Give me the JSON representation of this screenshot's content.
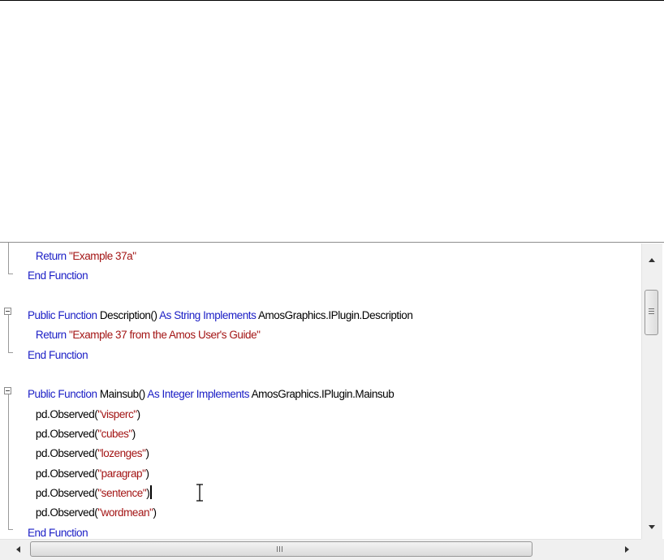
{
  "editor": {
    "lines": [
      {
        "indent": "   ",
        "tokens": [
          {
            "t": "Return ",
            "c": "kw"
          },
          {
            "t": "\"Example 37a\"",
            "c": "str"
          }
        ]
      },
      {
        "indent": "",
        "tokens": [
          {
            "t": "End Function",
            "c": "kw"
          }
        ]
      },
      {
        "indent": "",
        "tokens": []
      },
      {
        "indent": "",
        "tokens": [
          {
            "t": "Public Function ",
            "c": "kw"
          },
          {
            "t": "Description() ",
            "c": "plain"
          },
          {
            "t": "As String Implements ",
            "c": "kw"
          },
          {
            "t": "AmosGraphics.IPlugin.Description",
            "c": "plain"
          }
        ]
      },
      {
        "indent": "   ",
        "tokens": [
          {
            "t": "Return ",
            "c": "kw"
          },
          {
            "t": "\"Example 37 from the Amos User's Guide\"",
            "c": "str"
          }
        ]
      },
      {
        "indent": "",
        "tokens": [
          {
            "t": "End Function",
            "c": "kw"
          }
        ]
      },
      {
        "indent": "",
        "tokens": []
      },
      {
        "indent": "",
        "tokens": [
          {
            "t": "Public Function ",
            "c": "kw"
          },
          {
            "t": "Mainsub() ",
            "c": "plain"
          },
          {
            "t": "As Integer Implements ",
            "c": "kw"
          },
          {
            "t": "AmosGraphics.IPlugin.Mainsub",
            "c": "plain"
          }
        ]
      },
      {
        "indent": "   ",
        "tokens": [
          {
            "t": "pd.Observed(",
            "c": "plain"
          },
          {
            "t": "\"visperc\"",
            "c": "str"
          },
          {
            "t": ")",
            "c": "plain"
          }
        ]
      },
      {
        "indent": "   ",
        "tokens": [
          {
            "t": "pd.Observed(",
            "c": "plain"
          },
          {
            "t": "\"cubes\"",
            "c": "str"
          },
          {
            "t": ")",
            "c": "plain"
          }
        ]
      },
      {
        "indent": "   ",
        "tokens": [
          {
            "t": "pd.Observed(",
            "c": "plain"
          },
          {
            "t": "\"lozenges\"",
            "c": "str"
          },
          {
            "t": ")",
            "c": "plain"
          }
        ]
      },
      {
        "indent": "   ",
        "tokens": [
          {
            "t": "pd.Observed(",
            "c": "plain"
          },
          {
            "t": "\"paragrap\"",
            "c": "str"
          },
          {
            "t": ")",
            "c": "plain"
          }
        ]
      },
      {
        "indent": "   ",
        "tokens": [
          {
            "t": "pd.Observed(",
            "c": "plain"
          },
          {
            "t": "\"sentence\"",
            "c": "str"
          },
          {
            "t": ")",
            "c": "plain"
          }
        ],
        "caret": true
      },
      {
        "indent": "   ",
        "tokens": [
          {
            "t": "pd.Observed(",
            "c": "plain"
          },
          {
            "t": "\"wordmean\"",
            "c": "str"
          },
          {
            "t": ")",
            "c": "plain"
          }
        ]
      },
      {
        "indent": "",
        "tokens": [
          {
            "t": "End Function",
            "c": "kw"
          }
        ]
      }
    ],
    "colors": {
      "keyword": "#1d20c6",
      "string": "#a31515",
      "text": "#000000"
    }
  },
  "icons": {
    "collapse": "collapse-box-icon",
    "scroll_up": "arrow-up-icon",
    "scroll_down": "arrow-down-icon",
    "scroll_left": "arrow-left-icon",
    "scroll_right": "arrow-right-icon",
    "cursor": "ibeam-cursor-icon"
  }
}
